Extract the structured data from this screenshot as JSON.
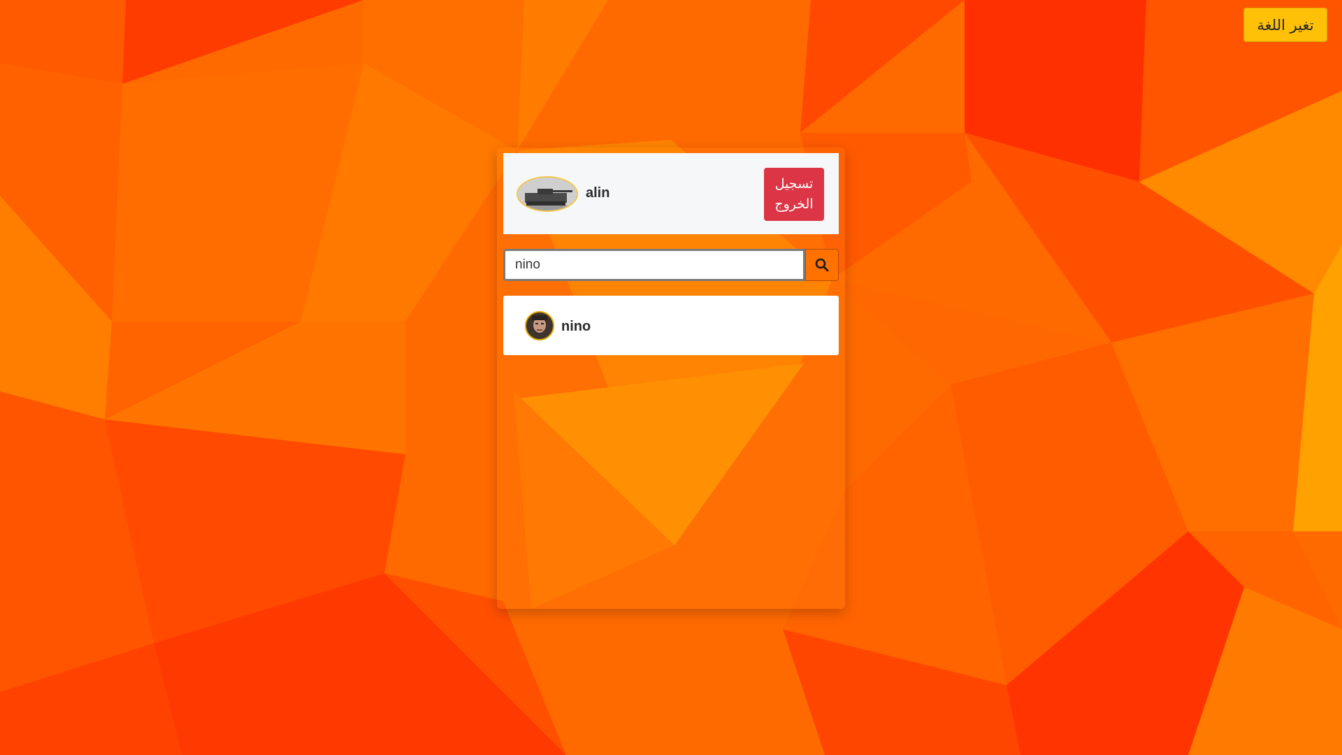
{
  "header": {
    "language_button_label": "تغير اللغة",
    "username": "alin",
    "logout_label": "تسجيل الخروج"
  },
  "search": {
    "value": "nino"
  },
  "results": [
    {
      "name": "nino"
    }
  ],
  "colors": {
    "background": "#ff6a00",
    "language_button": "#ffc107",
    "logout_button": "#dc3545",
    "search_button": "#ff7200",
    "card": "#ffffff",
    "header_card": "#f6f7f9"
  },
  "icons": {
    "search_button": "search-icon",
    "user_avatar": "avatar",
    "result_avatar": "avatar"
  }
}
